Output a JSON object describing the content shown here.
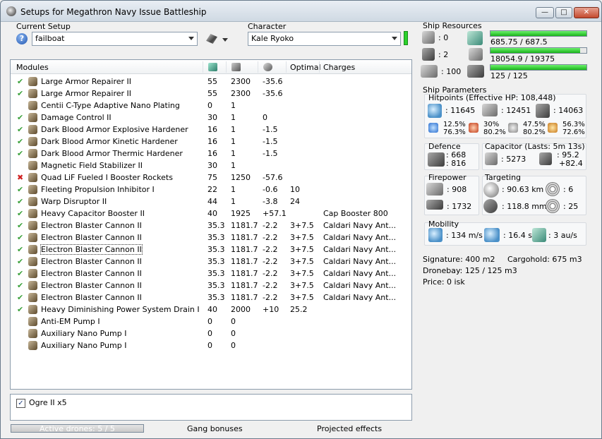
{
  "window": {
    "title": "Setups for Megathron Navy Issue Battleship"
  },
  "setup": {
    "label": "Current Setup",
    "value": "failboat"
  },
  "character": {
    "label": "Character",
    "value": "Kale Ryoko"
  },
  "modules": {
    "headers": {
      "modules": "Modules",
      "optimal": "Optimal",
      "charges": "Charges"
    },
    "rows": [
      {
        "status": "ok",
        "name": "Large Armor Repairer II",
        "c1": "55",
        "c2": "2300",
        "c3": "-35.6",
        "optimal": "",
        "charges": ""
      },
      {
        "status": "ok",
        "name": "Large Armor Repairer II",
        "c1": "55",
        "c2": "2300",
        "c3": "-35.6",
        "optimal": "",
        "charges": ""
      },
      {
        "status": "",
        "name": "Centii C-Type Adaptive Nano Plating",
        "c1": "0",
        "c2": "1",
        "c3": "",
        "optimal": "",
        "charges": ""
      },
      {
        "status": "ok",
        "name": "Damage Control II",
        "c1": "30",
        "c2": "1",
        "c3": "0",
        "optimal": "",
        "charges": ""
      },
      {
        "status": "ok",
        "name": "Dark Blood Armor Explosive Hardener",
        "c1": "16",
        "c2": "1",
        "c3": "-1.5",
        "optimal": "",
        "charges": ""
      },
      {
        "status": "ok",
        "name": "Dark Blood Armor Kinetic Hardener",
        "c1": "16",
        "c2": "1",
        "c3": "-1.5",
        "optimal": "",
        "charges": ""
      },
      {
        "status": "ok",
        "name": "Dark Blood Armor Thermic Hardener",
        "c1": "16",
        "c2": "1",
        "c3": "-1.5",
        "optimal": "",
        "charges": ""
      },
      {
        "status": "",
        "name": "Magnetic Field Stabilizer II",
        "c1": "30",
        "c2": "1",
        "c3": "",
        "optimal": "",
        "charges": ""
      },
      {
        "status": "err",
        "name": "Quad LiF Fueled I Booster Rockets",
        "c1": "75",
        "c2": "1250",
        "c3": "-57.6",
        "optimal": "",
        "charges": ""
      },
      {
        "status": "ok",
        "name": "Fleeting Propulsion Inhibitor I",
        "c1": "22",
        "c2": "1",
        "c3": "-0.6",
        "optimal": "10",
        "charges": ""
      },
      {
        "status": "ok",
        "name": "Warp Disruptor II",
        "c1": "44",
        "c2": "1",
        "c3": "-3.8",
        "optimal": "24",
        "charges": ""
      },
      {
        "status": "ok",
        "name": "Heavy Capacitor Booster II",
        "c1": "40",
        "c2": "1925",
        "c3": "+57.1",
        "optimal": "",
        "charges": "Cap Booster 800"
      },
      {
        "status": "ok",
        "name": "Electron Blaster Cannon II",
        "c1": "35.3",
        "c2": "1181.7",
        "c3": "-2.2",
        "optimal": "3+7.5",
        "charges": "Caldari Navy Ant..."
      },
      {
        "status": "ok",
        "name": "Electron Blaster Cannon II",
        "c1": "35.3",
        "c2": "1181.7",
        "c3": "-2.2",
        "optimal": "3+7.5",
        "charges": "Caldari Navy Ant..."
      },
      {
        "status": "ok",
        "name": "Electron Blaster Cannon II",
        "c1": "35.3",
        "c2": "1181.7",
        "c3": "-2.2",
        "optimal": "3+7.5",
        "charges": "Caldari Navy Ant..."
      },
      {
        "status": "ok",
        "name": "Electron Blaster Cannon II",
        "c1": "35.3",
        "c2": "1181.7",
        "c3": "-2.2",
        "optimal": "3+7.5",
        "charges": "Caldari Navy Ant..."
      },
      {
        "status": "ok",
        "name": "Electron Blaster Cannon II",
        "c1": "35.3",
        "c2": "1181.7",
        "c3": "-2.2",
        "optimal": "3+7.5",
        "charges": "Caldari Navy Ant..."
      },
      {
        "status": "ok",
        "name": "Electron Blaster Cannon II",
        "c1": "35.3",
        "c2": "1181.7",
        "c3": "-2.2",
        "optimal": "3+7.5",
        "charges": "Caldari Navy Ant..."
      },
      {
        "status": "ok",
        "name": "Electron Blaster Cannon II",
        "c1": "35.3",
        "c2": "1181.7",
        "c3": "-2.2",
        "optimal": "3+7.5",
        "charges": "Caldari Navy Ant..."
      },
      {
        "status": "ok",
        "name": "Heavy Diminishing Power System Drain I",
        "c1": "40",
        "c2": "2000",
        "c3": "+10",
        "optimal": "25.2",
        "charges": ""
      },
      {
        "status": "",
        "name": "Anti-EM Pump I",
        "c1": "0",
        "c2": "0",
        "c3": "",
        "optimal": "",
        "charges": ""
      },
      {
        "status": "",
        "name": "Auxiliary Nano Pump I",
        "c1": "0",
        "c2": "0",
        "c3": "",
        "optimal": "",
        "charges": ""
      },
      {
        "status": "",
        "name": "Auxiliary Nano Pump I",
        "c1": "0",
        "c2": "0",
        "c3": "",
        "optimal": "",
        "charges": ""
      }
    ]
  },
  "drones": {
    "item": "Ogre II x5",
    "checked": true,
    "active": "Active drones: 5 / 5",
    "active_fraction": 1.0
  },
  "footer": {
    "gang": "Gang bonuses",
    "projected": "Projected effects"
  },
  "resources": {
    "label": "Ship Resources",
    "turret": ": 0",
    "launcher": ": 2",
    "drone_bw": ": 100",
    "cpu": {
      "text": "685.75 / 687.5",
      "fraction": 0.9975
    },
    "power": {
      "text": "18054.9 / 19375",
      "fraction": 0.932
    },
    "calib": {
      "text": "125 / 125",
      "fraction": 1.0
    }
  },
  "params": {
    "label": "Ship Parameters",
    "hp_label": "Hitpoints (Effective HP: 108,448)",
    "shield": ": 11645",
    "armor": ": 12451",
    "structure": ": 14063",
    "res": [
      {
        "top": "12.5%",
        "bottom": "76.3%"
      },
      {
        "top": "30%",
        "bottom": "80.2%"
      },
      {
        "top": "47.5%",
        "bottom": "80.2%"
      },
      {
        "top": "56.3%",
        "bottom": "72.6%"
      }
    ],
    "defence": {
      "label": "Defence",
      "line1": ": 668",
      "line2": ": 816"
    },
    "capacitor": {
      "label": "Capacitor (Lasts: 5m 13s)",
      "amount": ": 5273",
      "line1": ": 95.2",
      "line2": "+82.4"
    },
    "firepower": {
      "label": "Firepower",
      "dps": ": 908",
      "volley": ": 1732"
    },
    "targeting": {
      "label": "Targeting",
      "range": ": 90.63 km",
      "targets": ": 6",
      "scan": ": 118.8 mm",
      "sensor": ": 25"
    },
    "mobility": {
      "label": "Mobility",
      "speed": ": 134 m/s",
      "align": ": 16.4 s",
      "warp": ": 3 au/s"
    },
    "signature": "Signature: 400 m2",
    "cargohold": "Cargohold: 675 m3",
    "dronebay": "Dronebay: 125 / 125 m3",
    "price": "Price: 0 isk"
  }
}
